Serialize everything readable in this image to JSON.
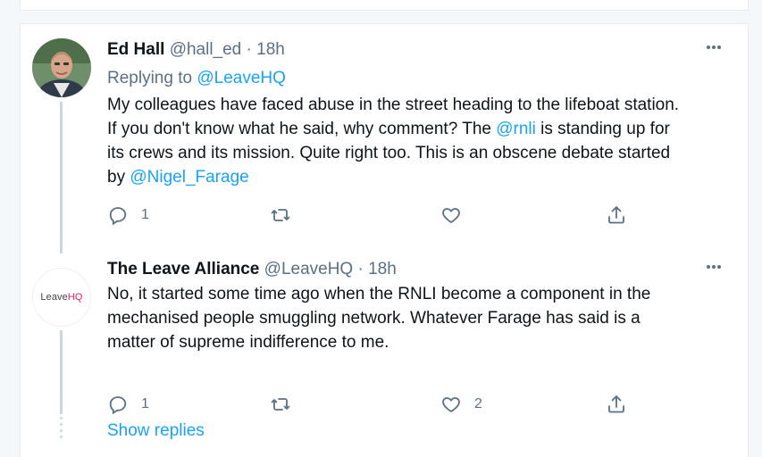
{
  "tweets": [
    {
      "name": "Ed Hall",
      "handle": "@hall_ed",
      "separator": "·",
      "time": "18h",
      "replying_prefix": "Replying to ",
      "replying_to": "@LeaveHQ",
      "body_line1": "My colleagues have faced abuse in the street heading to the lifeboat station.",
      "body_line2a": "If you don't know what he said, why comment? The ",
      "body_mention1": "@rnli",
      "body_line2b": " is standing up for",
      "body_line3": "its crews and its mission. Quite right too. This is an obscene debate started",
      "body_line4a": "by ",
      "body_mention2": "@Nigel_Farage",
      "reply_count": "1",
      "retweet_count": "",
      "like_count": "",
      "avatar_icon": "profile-photo"
    },
    {
      "name": "The Leave Alliance",
      "handle": "@LeaveHQ",
      "separator": "·",
      "time": "18h",
      "avatar_logo_a": "Leave",
      "avatar_logo_b": "HQ",
      "body_line1": "No, it started some time ago when the RNLI become a component in the",
      "body_line2": "mechanised people smuggling network. Whatever Farage has said is a",
      "body_line3": "matter of supreme indifference to me.",
      "reply_count": "1",
      "retweet_count": "",
      "like_count": "2"
    }
  ],
  "show_replies": "Show replies",
  "colors": {
    "accent": "#1da1f2",
    "secondary_text": "#5b7083",
    "primary_text": "#0f1419",
    "border": "#e6ecf0",
    "thread_line": "#ccd6dd"
  }
}
